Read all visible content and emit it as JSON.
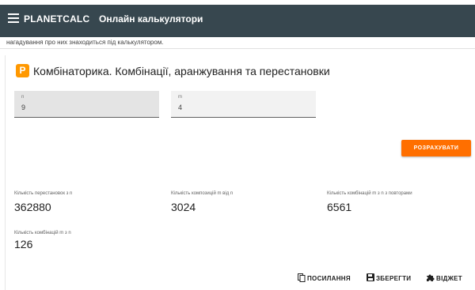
{
  "header": {
    "brand": "PLANETCALC",
    "title": "Онлайн калькулятори"
  },
  "note": "нагадування про них знаходиться під калькулятором.",
  "calculator": {
    "icon_letter": "P",
    "title": "Комбінаторика. Комбінації, аранжування та перестановки",
    "fields": {
      "n": {
        "label": "n",
        "value": "9"
      },
      "m": {
        "label": "m",
        "value": "4"
      }
    },
    "calculate_label": "РОЗРАХУВАТИ",
    "results": [
      {
        "label": "Кількість перестановок з n",
        "value": "362880"
      },
      {
        "label": "Кількість композицій m від n",
        "value": "3024"
      },
      {
        "label": "Кількість комбінацій m з n з повторами",
        "value": "6561"
      },
      {
        "label": "Кількість комбінацій m з n",
        "value": "126"
      }
    ]
  },
  "actions": {
    "link_label": "ПОСИЛАННЯ",
    "save_label": "ЗБЕРЕГТИ",
    "widget_label": "ВІДЖЕТ"
  },
  "colors": {
    "header_bg": "#37474f",
    "accent": "#ff6f00",
    "icon_orange": "#ff9800"
  }
}
